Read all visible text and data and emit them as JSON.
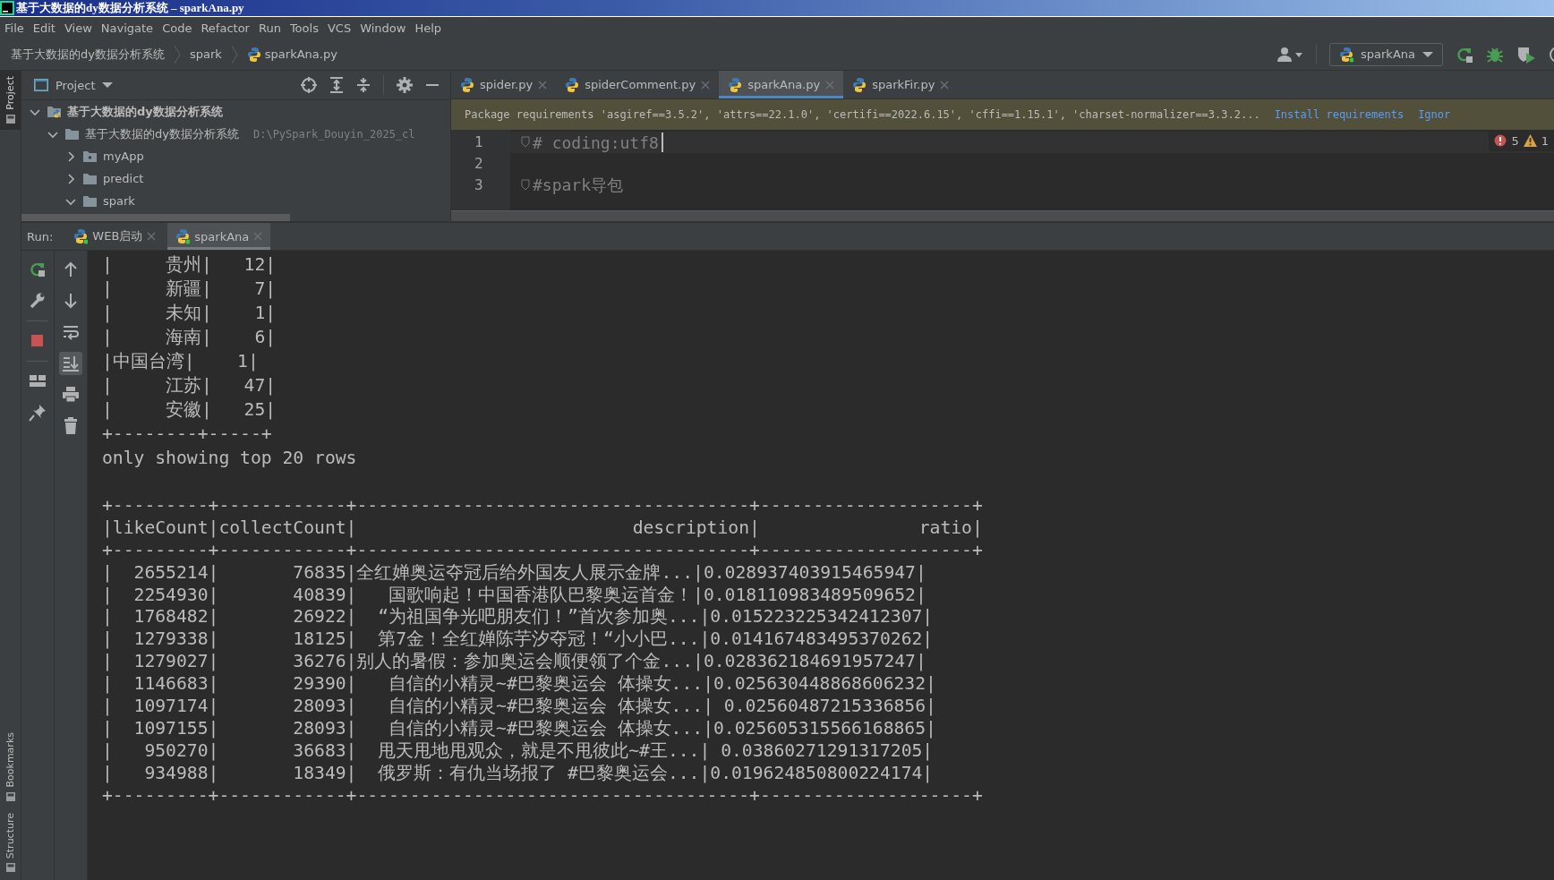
{
  "window": {
    "title": "基于大数据的dy数据分析系统 – sparkAna.py"
  },
  "menu": [
    {
      "label": "File"
    },
    {
      "label": "Edit"
    },
    {
      "label": "View"
    },
    {
      "label": "Navigate"
    },
    {
      "label": "Code"
    },
    {
      "label": "Refactor"
    },
    {
      "label": "Run"
    },
    {
      "label": "Tools"
    },
    {
      "label": "VCS"
    },
    {
      "label": "Window"
    },
    {
      "label": "Help"
    }
  ],
  "breadcrumbs": [
    {
      "label": "基于大数据的dy数据分析系统",
      "kind": "project"
    },
    {
      "label": "spark",
      "kind": "folder"
    },
    {
      "label": "sparkAna.py",
      "kind": "file"
    }
  ],
  "run_config": {
    "label": "sparkAna"
  },
  "side_tabs": [
    {
      "label": "Project",
      "selected": true,
      "kind": "top"
    },
    {
      "label": "Bookmarks",
      "selected": false,
      "kind": "bottom"
    },
    {
      "label": "Structure",
      "selected": false,
      "kind": "bottom"
    }
  ],
  "project_panel": {
    "title": "Project",
    "tree": [
      {
        "label": "基于大数据的dy数据分析系统",
        "kind": "project",
        "expanded": true,
        "children": [
          {
            "label": "基于大数据的dy数据分析系统",
            "path": "D:\\PySpark_Douyin_2025_cl",
            "kind": "folder",
            "expanded": true,
            "children": [
              {
                "label": "myApp",
                "kind": "package",
                "expanded": false
              },
              {
                "label": "predict",
                "kind": "folder",
                "expanded": false
              },
              {
                "label": "spark",
                "kind": "folder",
                "expanded": true
              }
            ]
          }
        ]
      }
    ]
  },
  "editor_tabs": [
    {
      "label": "spider.py",
      "selected": false
    },
    {
      "label": "spiderComment.py",
      "selected": false
    },
    {
      "label": "sparkAna.py",
      "selected": true
    },
    {
      "label": "sparkFir.py",
      "selected": false
    }
  ],
  "banner": {
    "message": "Package requirements 'asgiref==3.5.2', 'attrs==22.1.0', 'certifi==2022.6.15', 'cffi==1.15.1', 'charset-normalizer==3.3.2...",
    "links": [
      "Install requirements",
      "Ignor"
    ]
  },
  "editor": {
    "errors": "5",
    "warnings": "1",
    "lines": [
      {
        "number": "1",
        "code": "# coding:utf8"
      },
      {
        "number": "2"
      },
      {
        "number": "3",
        "code": "#spark导包"
      }
    ]
  },
  "run_tabs": [
    {
      "label": "WEB启动",
      "selected": false
    },
    {
      "label": "sparkAna",
      "selected": true
    }
  ],
  "run_label": "Run:",
  "run_toolbar": [
    {
      "kind": "rerun"
    },
    {
      "kind": "wrench"
    },
    {
      "kind": "stop"
    },
    {
      "kind": "layout"
    },
    {
      "kind": "pin"
    }
  ],
  "console_toolbar": [
    {
      "kind": "up",
      "selected": false
    },
    {
      "kind": "down",
      "selected": false
    },
    {
      "kind": "wrap",
      "selected": false
    },
    {
      "kind": "scroll-end",
      "selected": true
    },
    {
      "kind": "print",
      "selected": false
    },
    {
      "kind": "trash",
      "selected": false
    }
  ],
  "console": [
    [
      "|     贵州|   12|",
      "|     新疆|    7|",
      "|     未知|    1|",
      "|     海南|    6|",
      "|中国台湾|    1|",
      "|     江苏|   47|",
      "|     安徽|   25|",
      "+--------+-----+",
      "only showing top 20 rows"
    ],
    [
      "+---------+------------+-------------------------------------+--------------------+",
      "|likeCount|collectCount|                          description|               ratio|",
      "+---------+------------+-------------------------------------+--------------------+",
      "|  2655214|       76835|全红婵奥运夺冠后给外国友人展示金牌...|0.028937403915465947|",
      "|  2254930|       40839|   国歌响起！中国香港队巴黎奥运首金！|0.018110983489509652|",
      "|  1768482|       26922|  “为祖国争光吧朋友们！”首次参加奥...|0.015223225342412307|",
      "|  1279338|       18125|  第7金！全红婵陈芋汐夺冠！“小小巴...|0.014167483495370262|",
      "|  1279027|       36276|别人的暑假：参加奥运会顺便领了个金...|0.028362184691957247|",
      "|  1146683|       29390|   自信的小精灵~#巴黎奥运会 体操女...|0.025630448868606232|",
      "|  1097174|       28093|   自信的小精灵~#巴黎奥运会 体操女...| 0.02560487215336856|",
      "|  1097155|       28093|   自信的小精灵~#巴黎奥运会 体操女...|0.025605315566168865|",
      "|   950270|       36683|  甩天甩地甩观众，就是不甩彼此~#王...| 0.03860271291317205|",
      "|   934988|       18349|  俄罗斯：有仇当场报了 #巴黎奥运会...|0.019624850800224174|",
      "+---------+------------+-------------------------------------+--------------------+"
    ]
  ]
}
